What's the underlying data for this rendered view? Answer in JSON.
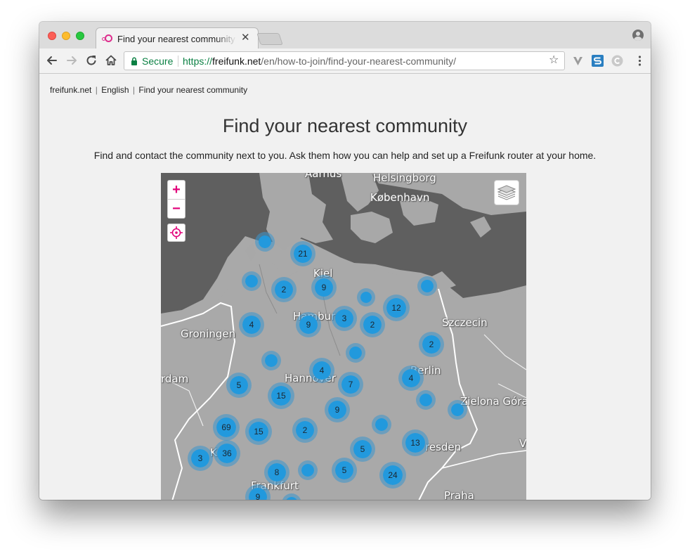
{
  "browser": {
    "tab_title": "Find your nearest community",
    "tab_close": "✕",
    "secure_label": "Secure",
    "url_scheme": "https://",
    "url_host": "freifunk.net",
    "url_path": "/en/how-to-join/find-your-nearest-community/",
    "colors": {
      "secure_green": "#0b8043",
      "brand_magenta": "#dd2e8d"
    },
    "icons": [
      "back-icon",
      "forward-icon",
      "reload-icon",
      "home-icon",
      "lock-icon",
      "star-icon",
      "vivaldi-ext-icon",
      "s-ext-icon",
      "c-ext-icon",
      "menu-icon",
      "profile-icon"
    ]
  },
  "page": {
    "breadcrumb": {
      "home": "freifunk.net",
      "sep": "|",
      "language": "English",
      "current": "Find your nearest community"
    },
    "title": "Find your nearest community",
    "intro": "Find and contact the community next to you. Ask them how you can help and set up a Freifunk router at your home."
  },
  "map": {
    "zoom_in": "+",
    "zoom_out": "−",
    "cities": {
      "aarhus": "Aarhus",
      "helsingborg": "Helsingborg",
      "kobenhavn": "København",
      "kiel": "Kiel",
      "hamburg": "Hamburg",
      "szczecin": "Szczecin",
      "groningen": "Groningen",
      "amsterdam": "rdam",
      "hannover": "Hannover",
      "berlin": "Berlin",
      "zielona": "Zielona Góra",
      "koln": "K",
      "dresden": "resden",
      "frankfurt": "Frankfurt",
      "praha": "Praha",
      "w": "V"
    },
    "clusters": {
      "c21": "21",
      "c2a": "2",
      "c9a": "9",
      "c12": "12",
      "c4a": "4",
      "c9b": "9",
      "c3a": "3",
      "c2b": "2",
      "c2c": "2",
      "c4b": "4",
      "c5a": "5",
      "c15a": "15",
      "c7": "7",
      "c4c": "4",
      "c9c": "9",
      "c69": "69",
      "c15b": "15",
      "c2d": "2",
      "c36": "36",
      "c3b": "3",
      "c5b": "5",
      "c13": "13",
      "c8": "8",
      "c5c": "5",
      "c24": "24",
      "c9d": "9"
    }
  }
}
